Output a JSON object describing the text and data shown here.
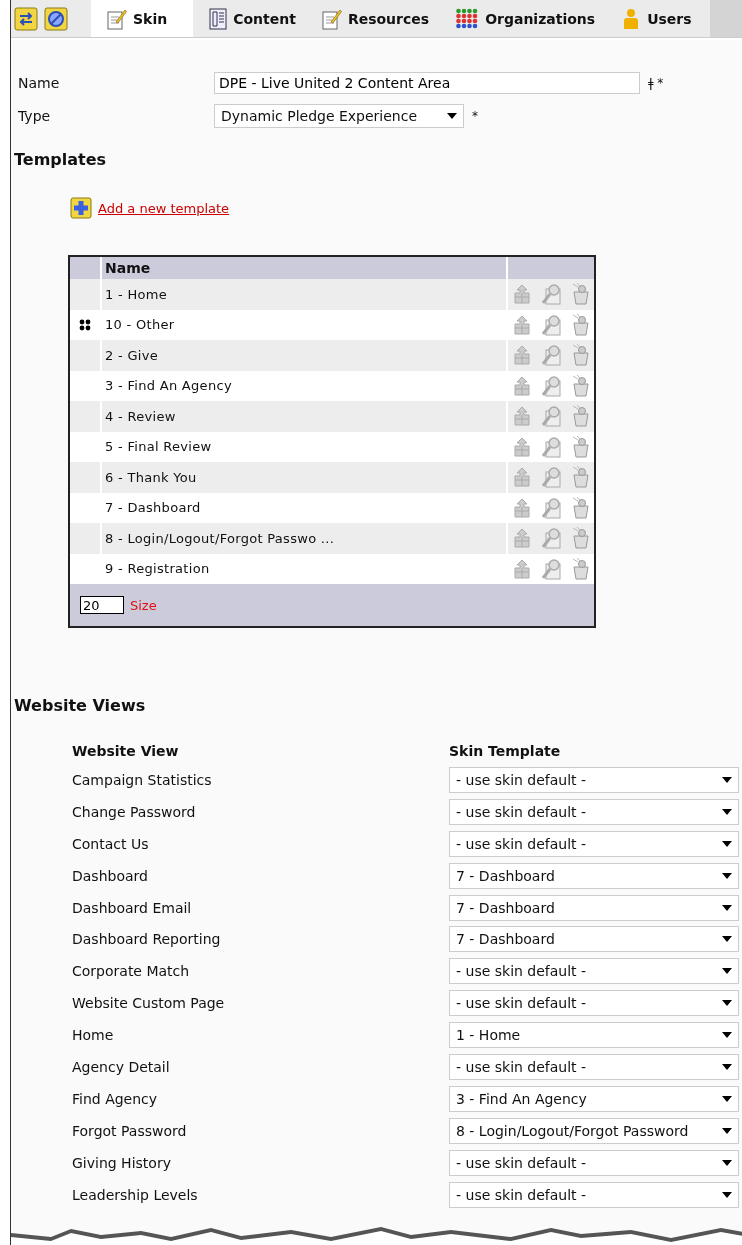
{
  "tabs": [
    {
      "label": "Skin",
      "kind": "note",
      "selected": true
    },
    {
      "label": "Content",
      "kind": "doc",
      "selected": false
    },
    {
      "label": "Resources",
      "kind": "note",
      "selected": false
    },
    {
      "label": "Organizations",
      "kind": "dots",
      "selected": false
    },
    {
      "label": "Users",
      "kind": "user",
      "selected": false
    }
  ],
  "form": {
    "name_label": "Name",
    "name_value": "DPE - Live United 2 Content Area",
    "name_marks": "ǂ *",
    "type_label": "Type",
    "type_value": "Dynamic Pledge Experience",
    "type_mark": "*"
  },
  "templates": {
    "heading": "Templates",
    "add_link": "Add a new template",
    "column": "Name",
    "rows": [
      {
        "name": "1 - Home",
        "handle": false
      },
      {
        "name": "10 - Other",
        "handle": true
      },
      {
        "name": "2 - Give",
        "handle": false
      },
      {
        "name": "3 - Find An Agency",
        "handle": false
      },
      {
        "name": "4 - Review",
        "handle": false
      },
      {
        "name": "5 - Final Review",
        "handle": false
      },
      {
        "name": "6 - Thank You",
        "handle": false
      },
      {
        "name": "7 - Dashboard",
        "handle": false
      },
      {
        "name": "8 - Login/Logout/Forgot Passwo ...",
        "handle": false
      },
      {
        "name": "9 - Registration",
        "handle": false
      }
    ],
    "page_size": "20",
    "size_label": "Size"
  },
  "website_views": {
    "heading": "Website Views",
    "col_view": "Website View",
    "col_template": "Skin Template",
    "rows": [
      {
        "view": "Campaign Statistics",
        "template": "- use skin default -"
      },
      {
        "view": "Change Password",
        "template": "- use skin default -"
      },
      {
        "view": "Contact Us",
        "template": "- use skin default -"
      },
      {
        "view": "Dashboard",
        "template": "7 - Dashboard"
      },
      {
        "view": "Dashboard Email",
        "template": "7 - Dashboard"
      },
      {
        "view": "Dashboard Reporting",
        "template": "7 - Dashboard"
      },
      {
        "view": "Corporate Match",
        "template": "- use skin default -"
      },
      {
        "view": "Website Custom Page",
        "template": "- use skin default -"
      },
      {
        "view": "Home",
        "template": "1 - Home"
      },
      {
        "view": "Agency Detail",
        "template": "- use skin default -"
      },
      {
        "view": "Find Agency",
        "template": "3 - Find An Agency"
      },
      {
        "view": "Forgot Password",
        "template": "8 - Login/Logout/Forgot Password"
      },
      {
        "view": "Giving History",
        "template": "- use skin default -"
      },
      {
        "view": "Leadership Levels",
        "template": "- use skin default -"
      }
    ]
  }
}
